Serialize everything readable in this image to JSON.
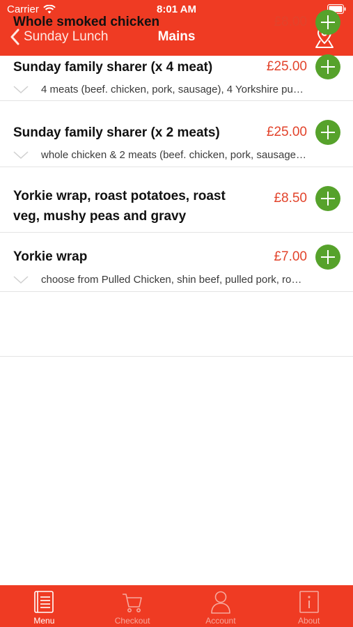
{
  "status_bar": {
    "carrier": "Carrier",
    "time": "8:01 AM"
  },
  "nav": {
    "back_label": "Sunday Lunch",
    "title": "Mains"
  },
  "items": [
    {
      "name": "Whole smoked chicken",
      "price": "£8.00",
      "description": ""
    },
    {
      "name": "Sunday family sharer (x 4 meat)",
      "price": "£25.00",
      "description": "4 meats (beef. chicken, pork, sausage), 4 Yorkshire pu…"
    },
    {
      "name": "Sunday family sharer (x 2 meats)",
      "price": "£25.00",
      "description": "whole chicken & 2 meats (beef. chicken, pork, sausage…"
    },
    {
      "name_line1": "Yorkie wrap, roast potatoes, roast",
      "name_line2": "veg, mushy peas and gravy",
      "price": "£8.50",
      "description": ""
    },
    {
      "name": "Yorkie wrap",
      "price": "£7.00",
      "description": "choose from Pulled Chicken, shin beef, pulled pork, ro…"
    }
  ],
  "tabs": [
    {
      "label": "Menu",
      "icon": "menu-book-icon",
      "active": true
    },
    {
      "label": "Checkout",
      "icon": "cart-icon",
      "active": false
    },
    {
      "label": "Account",
      "icon": "person-icon",
      "active": false
    },
    {
      "label": "About",
      "icon": "info-icon",
      "active": false
    }
  ],
  "colors": {
    "brand": "#ef3b23",
    "price": "#e2432b",
    "add_button": "#56a22b"
  }
}
